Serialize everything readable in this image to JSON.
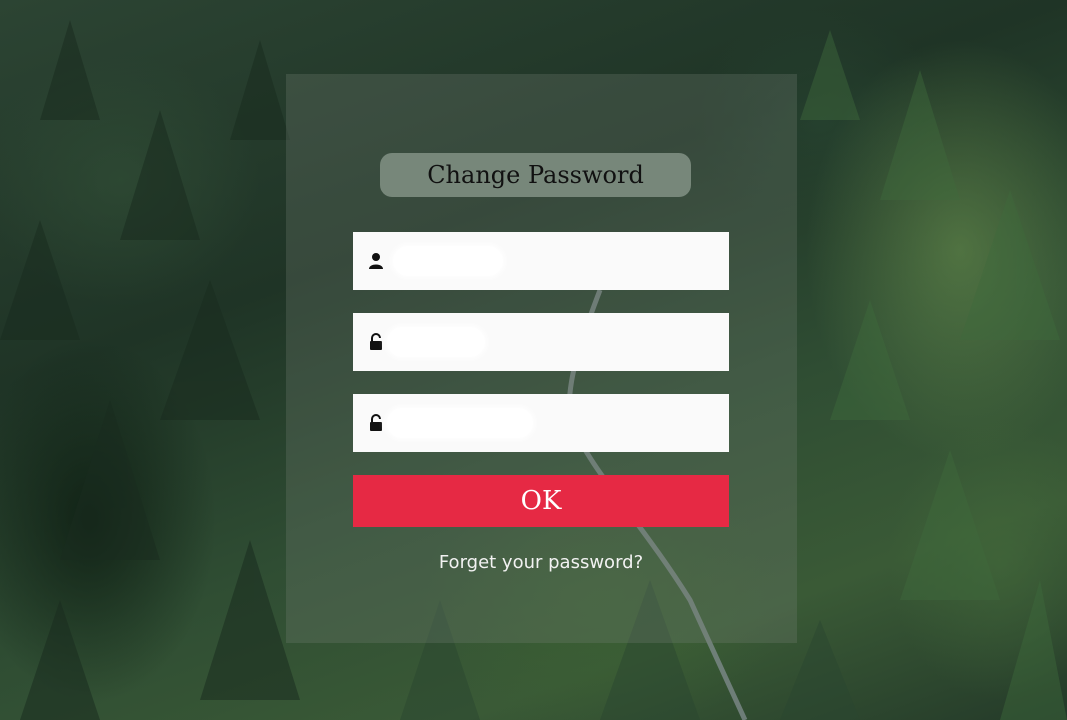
{
  "form": {
    "title": "Change Password",
    "fields": [
      {
        "icon": "user-icon",
        "value": "",
        "placeholder": ""
      },
      {
        "icon": "unlock-icon",
        "value": "",
        "placeholder": ""
      },
      {
        "icon": "unlock-icon",
        "value": "",
        "placeholder": ""
      }
    ],
    "submit_label": "OK",
    "forgot_link": "Forget your password?"
  },
  "colors": {
    "submit_button": "#e62944",
    "title_pill": "#77877a",
    "field_background": "#fafafa"
  }
}
